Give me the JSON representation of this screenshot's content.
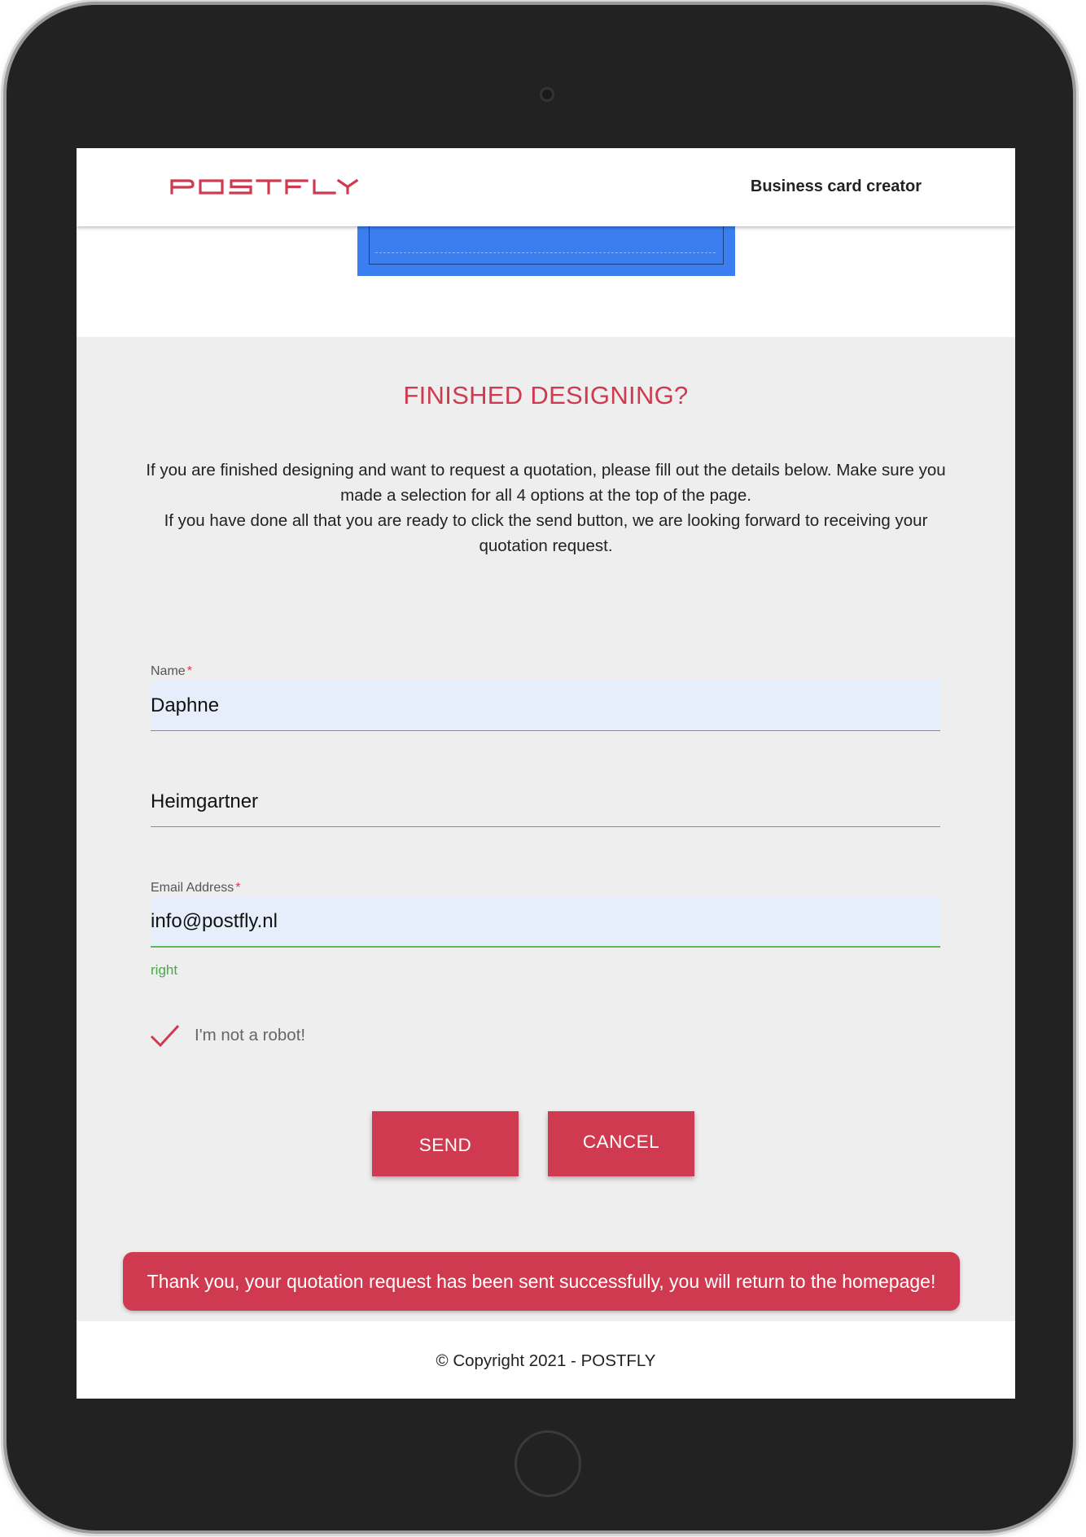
{
  "header": {
    "logo_text": "POSTFLY",
    "nav_link": "Business card creator"
  },
  "colors": {
    "accent": "#d03a50",
    "card_preview": "#3a7ef0",
    "autofill_bg": "#e7eefb",
    "valid": "#5cb85c"
  },
  "form_section": {
    "title": "FINISHED DESIGNING?",
    "intro": [
      "If you are finished designing and want to request a quotation, please fill out the details below. Make sure you made a selection for all 4 options at the top of the page.",
      "If you have done all that you are ready to click the send button, we are looking forward to receiving your quotation request."
    ]
  },
  "fields": {
    "name": {
      "label": "Name",
      "required_mark": "*",
      "value": "Daphne"
    },
    "lastname": {
      "value": "Heimgartner"
    },
    "email": {
      "label": "Email Address",
      "required_mark": "*",
      "value": "info@postfly.nl",
      "hint": "right"
    }
  },
  "robot_check": {
    "label": "I'm not a robot!",
    "checked": true,
    "icon": "checkmark-icon"
  },
  "buttons": {
    "send": "SEND",
    "cancel": "CANCEL"
  },
  "toast": {
    "message": "Thank you, your quotation request has been sent successfully, you will return to the homepage!"
  },
  "footer": {
    "copyright": "© Copyright 2021 - POSTFLY"
  }
}
